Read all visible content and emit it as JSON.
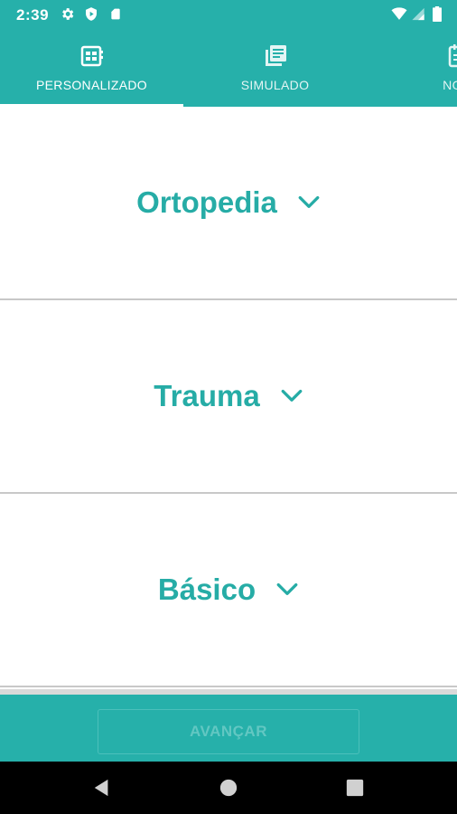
{
  "status_bar": {
    "time": "2:39",
    "icons": [
      "gear-icon",
      "shield-icon",
      "sd-card-icon",
      "wifi-icon",
      "signal-icon",
      "battery-icon"
    ]
  },
  "tabs": [
    {
      "label": "PERSONALIZADO",
      "icon": "grid-note-icon",
      "selected": true
    },
    {
      "label": "SIMULADO",
      "icon": "stack-list-icon",
      "selected": false
    },
    {
      "label": "NOTI",
      "icon": "calendar-icon",
      "selected": false
    }
  ],
  "categories": [
    {
      "title": "Ortopedia"
    },
    {
      "title": "Trauma"
    },
    {
      "title": "Básico"
    }
  ],
  "advance_button": {
    "label": "AVANÇAR",
    "enabled": false
  },
  "colors": {
    "primary": "#26b0aa",
    "accent_text": "#26aca6",
    "white": "#ffffff"
  },
  "nav": [
    "back-icon",
    "home-icon",
    "recents-icon"
  ]
}
